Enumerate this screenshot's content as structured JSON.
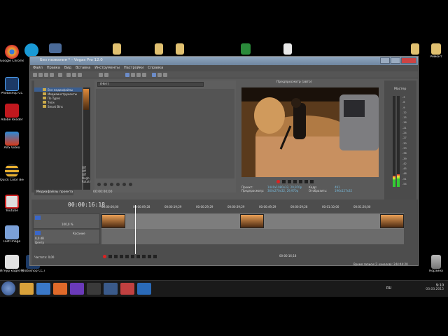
{
  "desktop": {
    "icons_left": [
      {
        "label": "Google Chrome",
        "color": "#e8b030"
      },
      {
        "label": "Skype",
        "color": "#1a9ad6"
      },
      {
        "label": "Photoshop CC",
        "color": "#1c3a66"
      },
      {
        "label": "Adobe Reader",
        "color": "#c0181e"
      },
      {
        "label": "AVS Video",
        "color": "#d93a1a"
      },
      {
        "label": "Quick Color Bee",
        "color": "#e8b030"
      },
      {
        "label": "Youtube",
        "color": "#cc2a2a"
      },
      {
        "label": "Fast Image",
        "color": "#5a7ab8"
      },
      {
        "label": "Игнур кадеэтр",
        "color": "#c9c9c9"
      },
      {
        "label": "Photoshop CC.dt4",
        "color": "#1c3a66"
      }
    ],
    "icons_right": [
      {
        "label": "Ремонт",
        "color": "#d9b050"
      },
      {
        "label": "Корзина",
        "color": "#9aa"
      }
    ]
  },
  "vegas": {
    "title": "Без названия * - Vegas Pro 12.0",
    "menu": [
      "Файл",
      "Правка",
      "Вид",
      "Вставка",
      "Инструменты",
      "Настройки",
      "Справка"
    ],
    "explorer": {
      "items": [
        "Все медиафайлы",
        "Медиаинструменты",
        "По Types",
        "Теги",
        "Smart Bins"
      ],
      "side": [
        "Off",
        "Off",
        "Off",
        "Nugb",
        "Rotatr"
      ],
      "tab": "Медиафайлы проекта"
    },
    "fx": {
      "preset": "(Нет)",
      "time": "00:00:00;00"
    },
    "preview": {
      "header": "Предпросмотр (авто)",
      "info": [
        {
          "k": "Проект:",
          "v": "1440x1080x32, 29,970p",
          "k2": "Кадр:",
          "v2": "491"
        },
        {
          "k": "Предпросмотр:",
          "v": "360x270x32, 29,970p",
          "k2": "Отобразить:",
          "v2": "196x127x32"
        }
      ]
    },
    "master": {
      "label": "Мастер",
      "scale": [
        "-3",
        "-6",
        "-9",
        "-12",
        "-15",
        "-18",
        "-21",
        "-24",
        "-27",
        "-30",
        "-33",
        "-36",
        "-39",
        "-42",
        "-45",
        "-48",
        "-51",
        "-54"
      ]
    },
    "timeline": {
      "timecode": "00:00:16:18",
      "ruler": [
        "00:00:00;00",
        "00:00:09;28",
        "00:00:19;29",
        "00:00:29;29",
        "00:00:39;29",
        "00:00:49;29",
        "00:00:59;28",
        "00:01:10;00",
        "00:01:20;00"
      ],
      "video_header": {
        "level": "100,0 %"
      },
      "audio_header": {
        "vol": "0,0 dB",
        "pan": "Центр",
        "mode": "Касание"
      },
      "speed": "Частота: 0,00",
      "end_time": "00:00:16;18",
      "status": "Время записи (2 каналов): 244:44:20"
    }
  },
  "taskbar": {
    "apps": [
      {
        "name": "explorer",
        "color": "#d9a13a"
      },
      {
        "name": "media-player",
        "color": "#3a78c8"
      },
      {
        "name": "chrome",
        "color": "#e06a2a"
      },
      {
        "name": "visual-studio",
        "color": "#6a3ab8"
      },
      {
        "name": "vegas",
        "color": "#3a3a3a"
      },
      {
        "name": "screen",
        "color": "#3a5a8a"
      },
      {
        "name": "movie-maker",
        "color": "#c04040"
      },
      {
        "name": "app",
        "color": "#2a6ab8"
      }
    ],
    "lang": "RU",
    "time": "9:10",
    "date": "03.03.2015"
  }
}
